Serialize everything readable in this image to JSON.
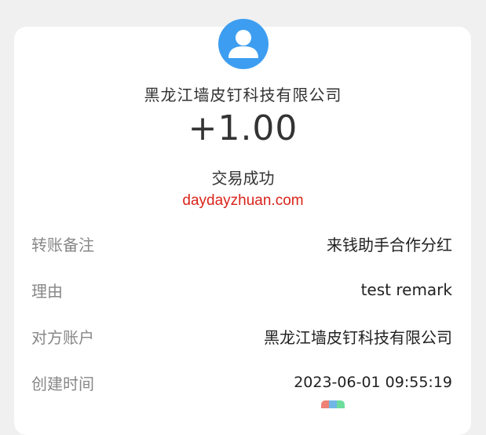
{
  "transaction": {
    "payer_name": "黑龙江墙皮钉科技有限公司",
    "amount": "+1.00",
    "status": "交易成功",
    "watermark": "daydayzhuan.com"
  },
  "details": {
    "rows": [
      {
        "label": "转账备注",
        "value": "来钱助手合作分红"
      },
      {
        "label": "理由",
        "value": "test remark"
      },
      {
        "label": "对方账户",
        "value": "黑龙江墙皮钉科技有限公司"
      },
      {
        "label": "创建时间",
        "value": "2023-06-01 09:55:19"
      }
    ]
  },
  "icons": {
    "avatar": "user-avatar-icon",
    "avatar_color": "#3d9ef1",
    "watermark_color": "#d9241b"
  }
}
